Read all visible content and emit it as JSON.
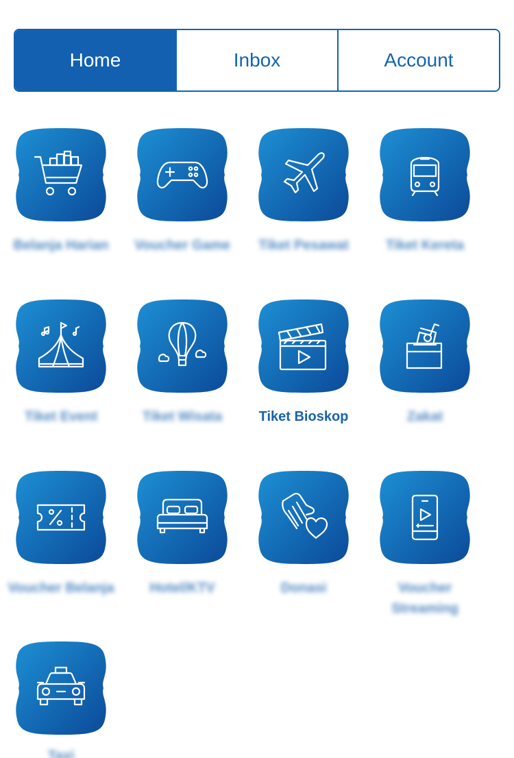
{
  "tabs": [
    {
      "label": "Home",
      "active": true
    },
    {
      "label": "Inbox",
      "active": false
    },
    {
      "label": "Account",
      "active": false
    }
  ],
  "menu": [
    {
      "icon": "shopping-cart-icon",
      "label": "Belanja Harian",
      "blurred": true
    },
    {
      "icon": "gamepad-icon",
      "label": "Voucher Game",
      "blurred": true
    },
    {
      "icon": "airplane-icon",
      "label": "Tiket Pesawat",
      "blurred": true
    },
    {
      "icon": "train-icon",
      "label": "Tiket Kereta",
      "blurred": true
    },
    {
      "icon": "event-tent-icon",
      "label": "Tiket Event",
      "blurred": true
    },
    {
      "icon": "hot-air-balloon-icon",
      "label": "Tiket Wisata",
      "blurred": true
    },
    {
      "icon": "clapperboard-icon",
      "label": "Tiket Bioskop",
      "blurred": false
    },
    {
      "icon": "donation-box-icon",
      "label": "Zakat",
      "blurred": true
    },
    {
      "icon": "discount-ticket-icon",
      "label": "Voucher Belanja",
      "blurred": true
    },
    {
      "icon": "bed-icon",
      "label": "Hotel/KTV",
      "blurred": true
    },
    {
      "icon": "charity-hand-heart-icon",
      "label": "Donasi",
      "blurred": true
    },
    {
      "icon": "mobile-streaming-icon",
      "label": "Voucher Streaming",
      "blurred": true
    },
    {
      "icon": "taxi-icon",
      "label": "Taxi",
      "blurred": true
    }
  ],
  "colors": {
    "accent": "#1360b0",
    "icon_gradient_top": "#1a8ad0",
    "icon_gradient_bottom": "#0d4f9e"
  }
}
